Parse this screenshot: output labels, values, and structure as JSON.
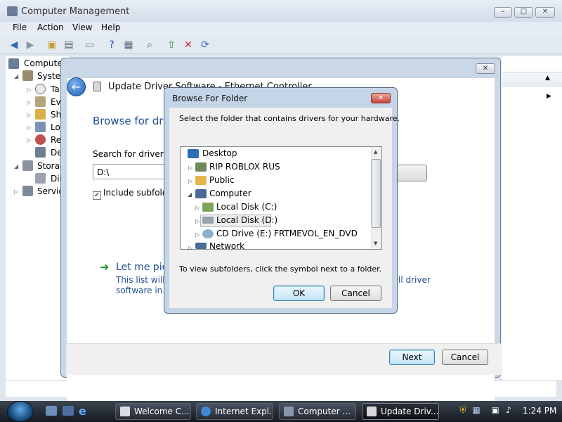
{
  "window": {
    "title": "Computer Management",
    "menu": [
      "File",
      "Action",
      "View",
      "Help"
    ]
  },
  "tree": {
    "items": [
      "Computer",
      "System",
      "Ta",
      "Eve",
      "Sh",
      "Lo",
      "Re",
      "De",
      "Storag",
      "Dis",
      "Service"
    ]
  },
  "wizard": {
    "title": "Update Driver Software - Ethernet Controller",
    "heading": "Browse for driv",
    "search_label": "Search for driver so",
    "path_value": "D:\\",
    "include_subfolders": "Include subfolde",
    "let_me": "Let me pic",
    "desc_line1": "This list will s",
    "desc_line1_end": "ll driver",
    "desc_line2": "software in th",
    "next": "Next",
    "cancel": "Cancel"
  },
  "browse": {
    "title": "Browse For Folder",
    "prompt": "Select the folder that contains drivers for your hardware.",
    "items": [
      "Desktop",
      "RIP ROBLOX RUS",
      "Public",
      "Computer",
      "Local Disk (C:)",
      "Local Disk (D:)",
      "CD Drive (E:) FRTMEVOL_EN_DVD",
      "Network"
    ],
    "hint": "To view subfolders, click the symbol next to a folder.",
    "ok": "OK",
    "cancel": "Cancel"
  },
  "taskbar": {
    "buttons": [
      "Welcome C...",
      "Internet Expl...",
      "Computer ...",
      "Update Driv..."
    ],
    "time": "1:24 PM"
  }
}
